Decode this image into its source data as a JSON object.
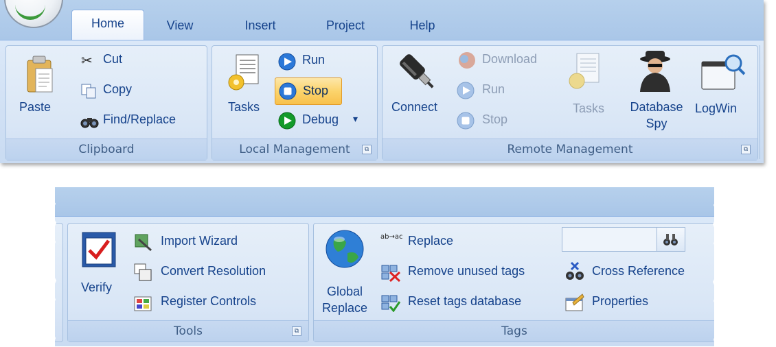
{
  "ribbon_top": {
    "tabs": [
      "Home",
      "View",
      "Insert",
      "Project",
      "Help"
    ],
    "clipboard": {
      "paste": "Paste",
      "cut": "Cut",
      "copy": "Copy",
      "find_replace": "Find/Replace",
      "group_label": "Clipboard"
    },
    "local_management": {
      "tasks": "Tasks",
      "run": "Run",
      "stop": "Stop",
      "debug": "Debug",
      "debug_arrow": "▾",
      "group_label": "Local Management"
    },
    "remote_management": {
      "connect": "Connect",
      "download": "Download",
      "run": "Run",
      "stop": "Stop",
      "tasks": "Tasks",
      "database_spy_line1": "Database",
      "database_spy_line2": "Spy",
      "logwin": "LogWin",
      "group_label": "Remote Management"
    }
  },
  "ribbon_bottom": {
    "tools": {
      "verify": "Verify",
      "import_wizard": "Import Wizard",
      "convert_resolution": "Convert Resolution",
      "register_controls": "Register Controls",
      "group_label": "Tools"
    },
    "tags": {
      "global_replace_line1": "Global",
      "global_replace_line2": "Replace",
      "replace": "Replace",
      "replace_icon_text": "ab→ac",
      "remove_unused_tags": "Remove unused tags",
      "reset_tags_database": "Reset tags database",
      "search_value": "",
      "cross_reference": "Cross Reference",
      "properties": "Properties",
      "group_label": "Tags"
    }
  },
  "launcher_glyph": "⧉",
  "colors": {
    "ribbon_text": "#15428b",
    "group_label_text": "#3e5d85",
    "disabled_text": "#8d9db5",
    "highlight": "#fbd46c"
  }
}
